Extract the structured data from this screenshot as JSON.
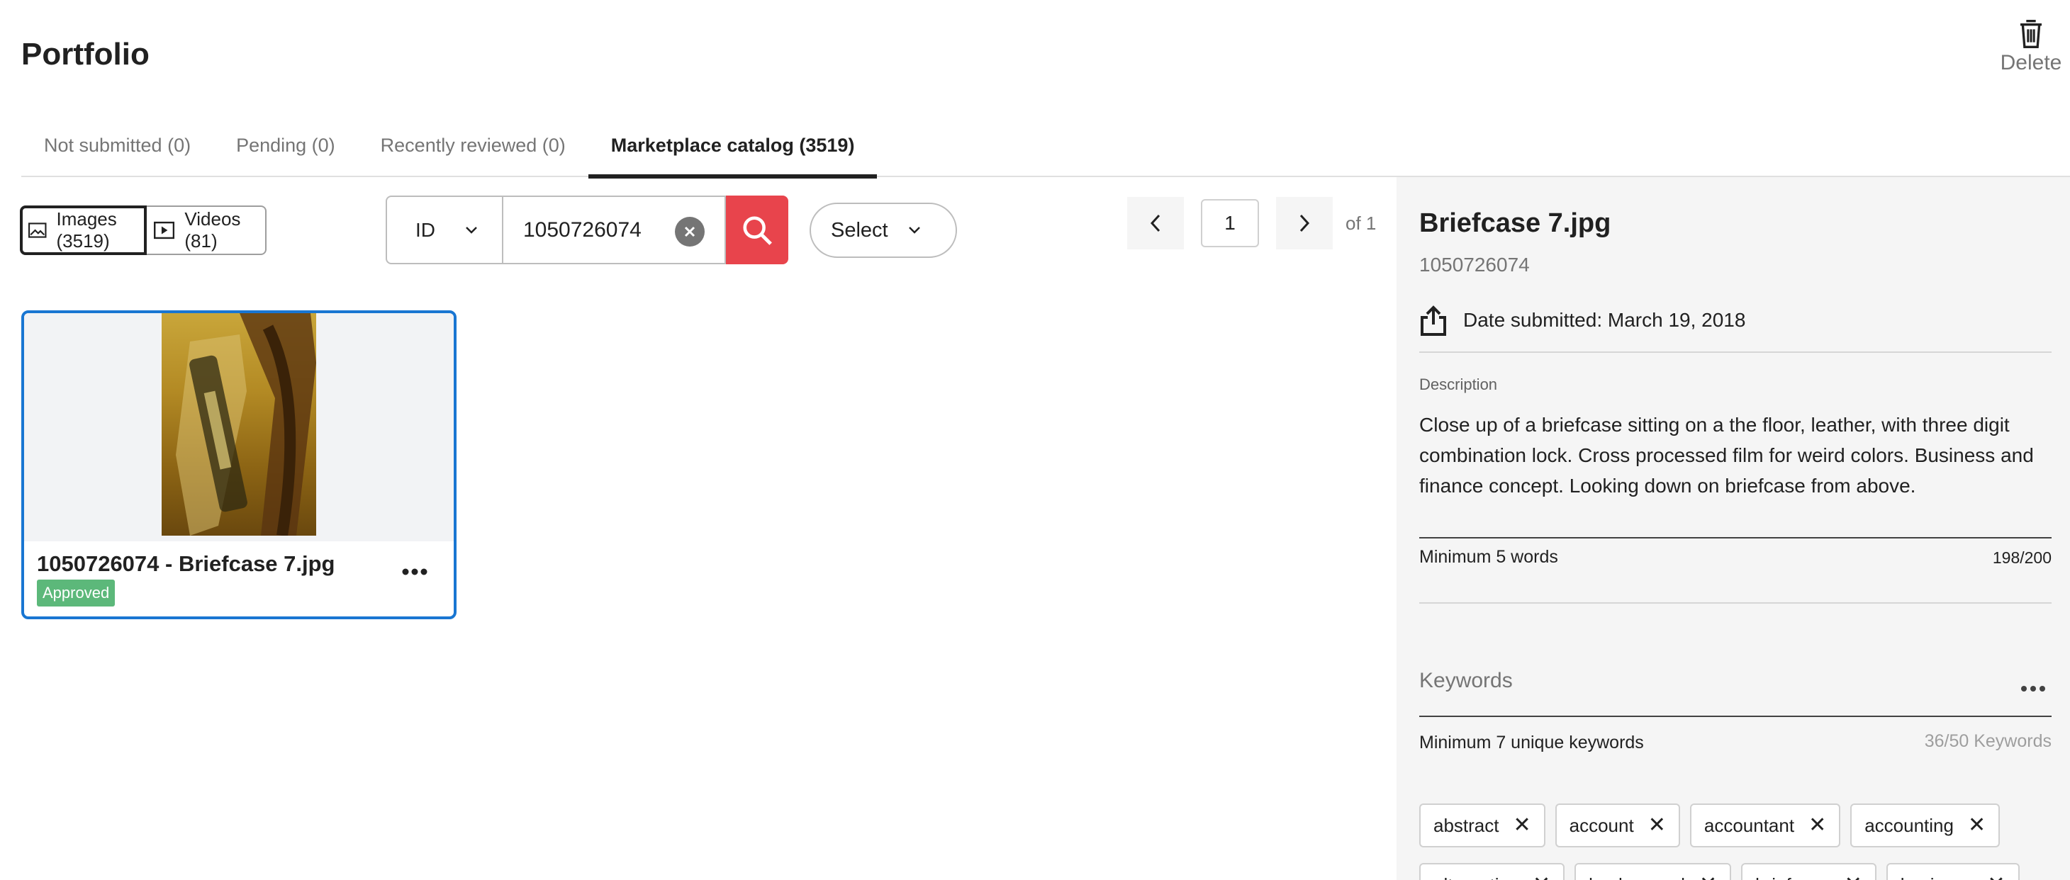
{
  "page": {
    "title": "Portfolio"
  },
  "header": {
    "delete_label": "Delete"
  },
  "tabs": [
    {
      "label": "Not submitted (0)"
    },
    {
      "label": "Pending (0)"
    },
    {
      "label": "Recently reviewed (0)"
    },
    {
      "label": "Marketplace catalog (3519)"
    }
  ],
  "media_toggle": {
    "images_label": "Images (3519)",
    "videos_label": "Videos (81)"
  },
  "search": {
    "field_type": "ID",
    "value": "1050726074"
  },
  "filter": {
    "label": "Select"
  },
  "pagination": {
    "current_page": "1",
    "of_label": "of 1"
  },
  "card": {
    "title": "1050726074 - Briefcase 7.jpg",
    "status": "Approved"
  },
  "details": {
    "filename": "Briefcase 7.jpg",
    "id": "1050726074",
    "date_submitted": "Date submitted: March 19, 2018",
    "description_label": "Description",
    "description": "Close up of a briefcase sitting on a the floor, leather, with three digit combination lock. Cross processed film for weird colors. Business and finance concept. Looking down on briefcase from above.",
    "description_hint": "Minimum 5 words",
    "description_count": "198/200",
    "keywords_label": "Keywords",
    "keywords_hint": "Minimum 7 unique keywords",
    "keywords_count": "36/50 Keywords",
    "keywords": [
      "abstract",
      "account",
      "accountant",
      "accounting",
      "alternative",
      "background",
      "briefcase",
      "business"
    ]
  },
  "colors": {
    "accent": "#e8444c",
    "selection": "#1976d2",
    "approved": "#5cb87a"
  }
}
